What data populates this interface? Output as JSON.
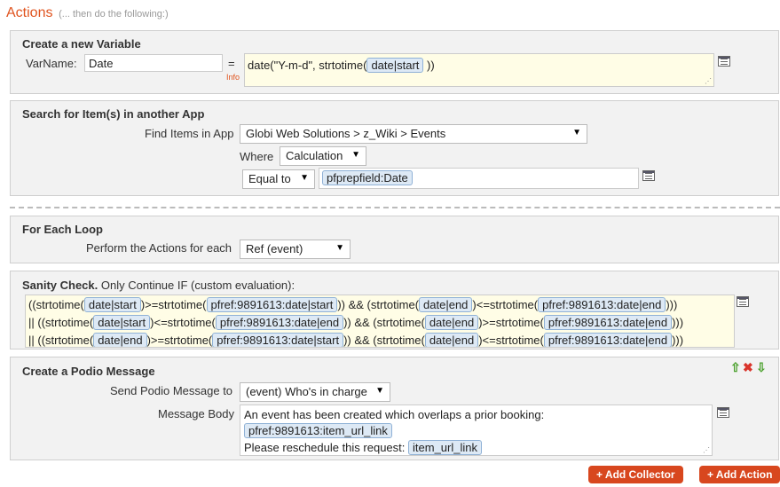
{
  "header": {
    "title": "Actions",
    "subtitle": "(... then do the following:)"
  },
  "variable": {
    "title": "Create a new Variable",
    "varname_label": "VarName:",
    "varname_value": "Date",
    "equals": "=",
    "info": "Info",
    "expr_prefix": "date(\"Y-m-d\", strtotime(",
    "expr_token": "date|start",
    "expr_suffix": "))"
  },
  "search": {
    "title": "Search for Item(s) in another App",
    "find_label": "Find Items in App",
    "find_value": "Globi Web Solutions > z_Wiki > Events",
    "where_label": "Where",
    "where_value": "Calculation",
    "operator_value": "Equal to",
    "token": "pfprepfield:Date"
  },
  "loop": {
    "title": "For Each Loop",
    "perform_label": "Perform the Actions for each",
    "perform_value": "Ref (event)"
  },
  "sanity": {
    "title": "Sanity Check.",
    "subtitle": "Only Continue IF (custom evaluation):",
    "lines": [
      [
        {
          "t": "((strtotime("
        },
        {
          "k": "date|start"
        },
        {
          "t": ")>=strtotime("
        },
        {
          "k": "pfref:9891613:date|start"
        },
        {
          "t": ")) && (strtotime("
        },
        {
          "k": "date|end"
        },
        {
          "t": ")<=strtotime("
        },
        {
          "k": "pfref:9891613:date|end"
        },
        {
          "t": ")))"
        }
      ],
      [
        {
          "t": "|| ((strtotime("
        },
        {
          "k": "date|start"
        },
        {
          "t": ")<=strtotime("
        },
        {
          "k": "pfref:9891613:date|end"
        },
        {
          "t": ")) && (strtotime("
        },
        {
          "k": "date|end"
        },
        {
          "t": ")>=strtotime("
        },
        {
          "k": "pfref:9891613:date|end"
        },
        {
          "t": ")))"
        }
      ],
      [
        {
          "t": "|| ((strtotime("
        },
        {
          "k": "date|end"
        },
        {
          "t": ")>=strtotime("
        },
        {
          "k": "pfref:9891613:date|start"
        },
        {
          "t": ")) && (strtotime("
        },
        {
          "k": "date|end"
        },
        {
          "t": ")<=strtotime("
        },
        {
          "k": "pfref:9891613:date|end"
        },
        {
          "t": ")))"
        }
      ]
    ]
  },
  "message": {
    "title": "Create a Podio Message",
    "send_label": "Send Podio Message to",
    "send_value": "(event) Who's in charge",
    "body_label": "Message Body",
    "body_line1": "An event has been created which overlaps a prior booking:",
    "body_token1": "pfref:9891613:item_url_link",
    "body_line3": "Please reschedule this request:",
    "body_token2": "item_url_link",
    "controls": {
      "up": "⇧",
      "delete": "✖",
      "down": "⇩"
    }
  },
  "buttons": {
    "add_collector": "+ Add Collector",
    "add_action": "+ Add Action"
  },
  "colors": {
    "accent": "#e0541f",
    "button": "#d8471e",
    "token_bg": "#dde9f5"
  }
}
